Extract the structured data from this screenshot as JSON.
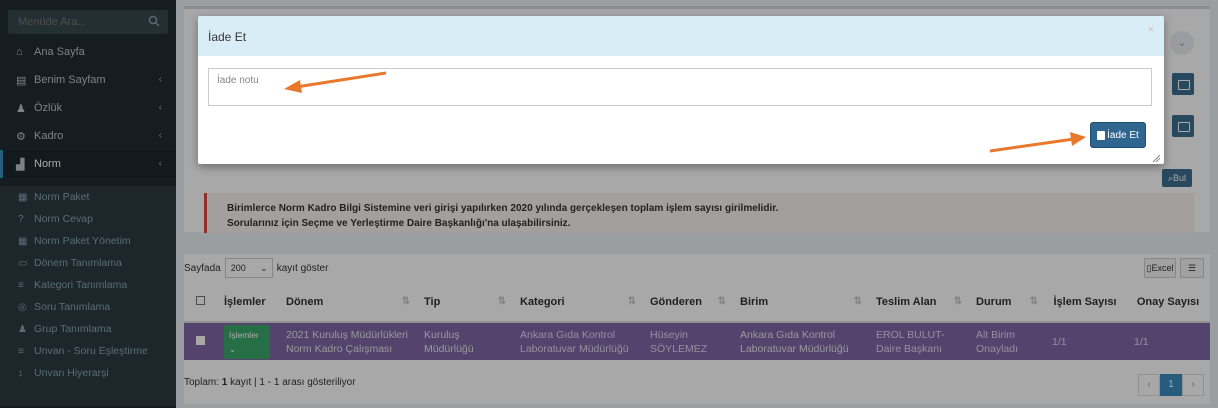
{
  "sidebar": {
    "search_placeholder": "Menüde Ara...",
    "items": [
      {
        "label": "Ana Sayfa",
        "icon": "home-icon",
        "glyph": "⌂"
      },
      {
        "label": "Benim Sayfam",
        "icon": "id-card-icon",
        "glyph": "▤"
      },
      {
        "label": "Özlük",
        "icon": "user-icon",
        "glyph": "♟"
      },
      {
        "label": "Kadro",
        "icon": "gear-icon",
        "glyph": "⚙"
      },
      {
        "label": "Norm",
        "icon": "chart-icon",
        "glyph": "▟"
      }
    ],
    "subitems": [
      {
        "label": "Norm Paket",
        "glyph": "▦"
      },
      {
        "label": "Norm Cevap",
        "glyph": "?"
      },
      {
        "label": "Norm Paket Yönetim",
        "glyph": "▦"
      },
      {
        "label": "Dönem Tanımlama",
        "glyph": "▭"
      },
      {
        "label": "Kategori Tanımlama",
        "glyph": "≡"
      },
      {
        "label": "Soru Tanımlama",
        "glyph": "◎"
      },
      {
        "label": "Grup Tanımlama",
        "glyph": "♟"
      },
      {
        "label": "Unvan - Soru Eşleştirme",
        "glyph": "≡"
      },
      {
        "label": "Unvan Hiyerarşi",
        "glyph": "↕"
      }
    ]
  },
  "notice": {
    "line1": "Birimlerce Norm Kadro Bilgi Sistemine veri girişi yapılırken 2020 yılında gerçekleşen toplam işlem sayısı girilmelidir.",
    "line2": "Sorularınız için Seçme ve Yerleştirme Daire Başkanlığı'na ulaşabilirsiniz."
  },
  "search_button": "Bul",
  "table_controls": {
    "length_prefix": "Sayfada",
    "length_value": "200",
    "length_suffix": "kayıt göster",
    "excel_label": "Excel"
  },
  "table": {
    "headers": [
      "",
      "İşlemler",
      "Dönem",
      "Tip",
      "Kategori",
      "Gönderen",
      "Birim",
      "Teslim Alan",
      "Durum",
      "İşlem Sayısı",
      "Onay Sayısı"
    ],
    "row": {
      "action": "İşlemler",
      "donem": "2021 Kuruluş Müdürlükleri Norm Kadro Çalışması",
      "tip": "Kuruluş Müdürlüğü",
      "kategori": "Ankara Gıda Kontrol Laboratuvar Müdürlüğü",
      "gonderen": "Hüseyin SÖYLEMEZ",
      "birim": "Ankara Gıda Kontrol Laboratuvar Müdürlüğü",
      "teslim_alan": "EROL BULUT-Daire Başkanı",
      "durum": "Alt Birim Onayladı",
      "islem_sayisi": "1/1",
      "onay_sayisi": "1/1"
    }
  },
  "footer": {
    "info_prefix": "Toplam:",
    "info_count": "1",
    "info_suffix": "kayıt | 1 - 1 arası gösteriliyor",
    "page": "1"
  },
  "modal": {
    "title": "İade Et",
    "textarea_placeholder": "İade notu",
    "submit_label": "İade Et"
  },
  "colors": {
    "sidebar_bg": "#222d32",
    "selected_row": "#8067a4",
    "modal_header": "#d9edf7",
    "primary_button": "#2e6690",
    "annotation_arrow": "#e8782c",
    "notice_border": "#dd4b39"
  }
}
